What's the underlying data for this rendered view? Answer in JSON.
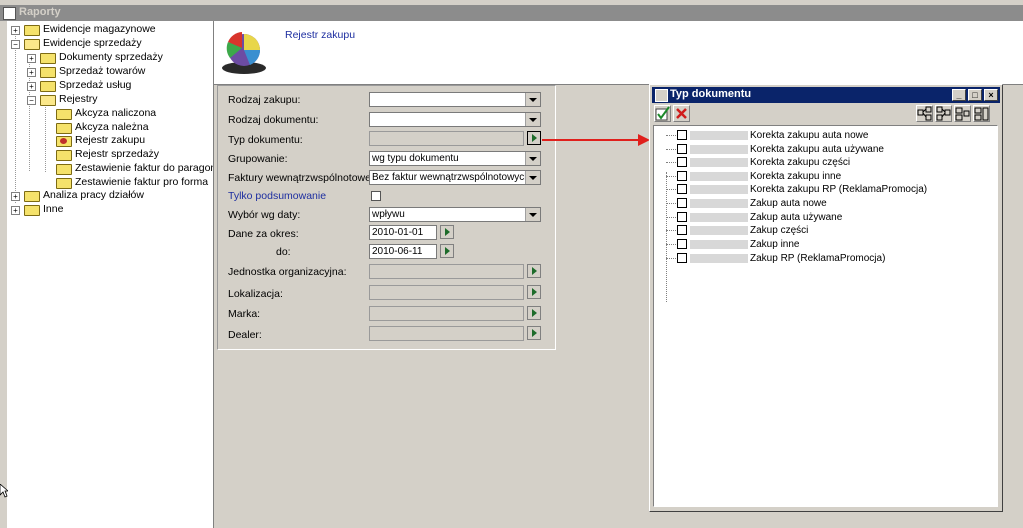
{
  "window": {
    "title": "Raporty"
  },
  "tree": {
    "items": [
      {
        "label": "Ewidencje magazynowe"
      },
      {
        "label": "Ewidencje sprzedaży"
      },
      {
        "label": "Dokumenty sprzedaży"
      },
      {
        "label": "Sprzedaż towarów"
      },
      {
        "label": "Sprzedaż usług"
      },
      {
        "label": "Rejestry"
      },
      {
        "label": "Akcyza naliczona"
      },
      {
        "label": "Akcyza należna"
      },
      {
        "label": "Rejestr zakupu"
      },
      {
        "label": "Rejestr sprzedaży"
      },
      {
        "label": "Zestawienie faktur do paragonów"
      },
      {
        "label": "Zestawienie faktur pro forma"
      },
      {
        "label": "Analiza pracy działów"
      },
      {
        "label": "Inne"
      }
    ]
  },
  "header": {
    "title": "Rejestr zakupu"
  },
  "form": {
    "rodzaj_zakupu": {
      "label": "Rodzaj zakupu:",
      "value": ""
    },
    "rodzaj_dokumentu": {
      "label": "Rodzaj dokumentu:",
      "value": ""
    },
    "typ_dokumentu": {
      "label": "Typ dokumentu:"
    },
    "grupowanie": {
      "label": "Grupowanie:",
      "value": "wg typu dokumentu"
    },
    "faktury": {
      "label": "Faktury wewnątrzwspólnotowe:",
      "value": "Bez faktur wewnątrzwspólnotowych"
    },
    "tylko": {
      "label": "Tylko podsumowanie",
      "checked": false
    },
    "wybor": {
      "label": "Wybór wg daty:",
      "value": "wpływu"
    },
    "dane": {
      "label": "Dane za okres:",
      "from": "2010-01-01",
      "to_label": "do:",
      "to": "2010-06-11"
    },
    "jednostka": {
      "label": "Jednostka organizacyjna:"
    },
    "lokalizacja": {
      "label": "Lokalizacja:"
    },
    "marka": {
      "label": "Marka:"
    },
    "dealer": {
      "label": "Dealer:"
    }
  },
  "popup": {
    "title": "Typ dokumentu",
    "items": [
      {
        "label": "Korekta zakupu auta nowe",
        "checked": false
      },
      {
        "label": "Korekta zakupu auta używane",
        "checked": false
      },
      {
        "label": "Korekta zakupu części",
        "checked": false
      },
      {
        "label": "Korekta zakupu inne",
        "checked": false
      },
      {
        "label": "Korekta zakupu RP (ReklamaPromocja)",
        "checked": false
      },
      {
        "label": "Zakup auta nowe",
        "checked": false
      },
      {
        "label": "Zakup auta używane",
        "checked": false
      },
      {
        "label": "Zakup części",
        "checked": false
      },
      {
        "label": "Zakup inne",
        "checked": false
      },
      {
        "label": "Zakup RP (ReklamaPromocja)",
        "checked": false
      }
    ]
  },
  "colors": {
    "accent": "#0a246a",
    "link": "#1d2ea0",
    "arrow": "#e0201c"
  }
}
